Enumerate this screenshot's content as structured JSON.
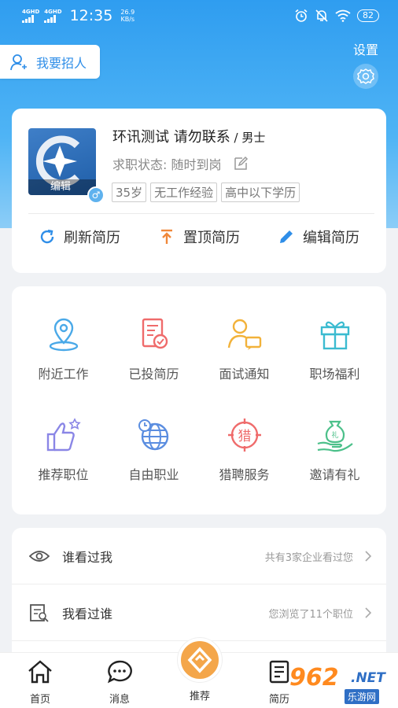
{
  "status_bar": {
    "network1": "4GHD",
    "network2": "4GHD",
    "time": "12:35",
    "speed_value": "26.9",
    "speed_unit": "KB/s",
    "battery": "82"
  },
  "header": {
    "recruit_label": "我要招人",
    "settings_label": "设置"
  },
  "profile": {
    "avatar_edit_label": "编辑",
    "gender_symbol": "♂",
    "name": "环讯测试 请勿联系",
    "gender_sep": " / ",
    "gender": "男士",
    "status_label": "求职状态:",
    "status_value": "随时到岗",
    "tags": [
      "35岁",
      "无工作经验",
      "高中以下学历"
    ],
    "actions": [
      {
        "label": "刷新简历",
        "icon": "refresh-icon",
        "color": "#2f8ee8"
      },
      {
        "label": "置顶简历",
        "icon": "pin-top-icon",
        "color": "#f0883a"
      },
      {
        "label": "编辑简历",
        "icon": "pencil-icon",
        "color": "#2f8ee8"
      }
    ]
  },
  "features": [
    {
      "label": "附近工作",
      "icon": "location-icon",
      "color": "#4aa9e8"
    },
    {
      "label": "已投简历",
      "icon": "resume-sent-icon",
      "color": "#ef6b6b"
    },
    {
      "label": "面试通知",
      "icon": "interview-icon",
      "color": "#f2b23a"
    },
    {
      "label": "职场福利",
      "icon": "gift-icon",
      "color": "#3bbbd0"
    },
    {
      "label": "推荐职位",
      "icon": "thumbs-up-icon",
      "color": "#8a86e6"
    },
    {
      "label": "自由职业",
      "icon": "globe-icon",
      "color": "#5a8de0"
    },
    {
      "label": "猎聘服务",
      "icon": "target-icon",
      "color": "#ef6b6b"
    },
    {
      "label": "邀请有礼",
      "icon": "money-hand-icon",
      "color": "#4cc08a"
    }
  ],
  "list": [
    {
      "title": "谁看过我",
      "info": "共有3家企业看过您",
      "icon": "eye-icon"
    },
    {
      "title": "我看过谁",
      "info": "您浏览了11个职位",
      "icon": "browse-history-icon"
    }
  ],
  "tabbar": {
    "tabs": [
      {
        "label": "首页",
        "icon": "home-icon"
      },
      {
        "label": "消息",
        "icon": "message-icon"
      },
      {
        "label": "推荐",
        "icon": "recommend-icon"
      },
      {
        "label": "简历",
        "icon": "resume-icon"
      }
    ]
  },
  "watermark": {
    "text": "962",
    "suffix": ".NET",
    "small": "乐游网"
  }
}
